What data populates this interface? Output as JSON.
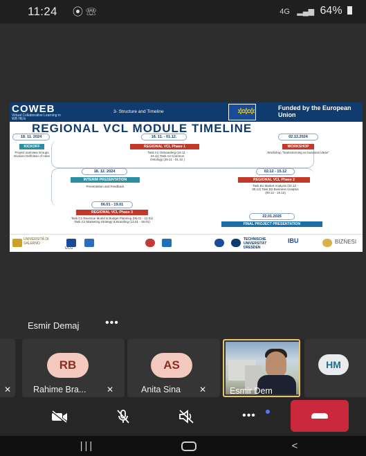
{
  "status_bar": {
    "time": "11:24",
    "left_icons": "⦿ ☏",
    "network": "4G",
    "battery": "64%"
  },
  "slide": {
    "brand": "COWEB",
    "brand_sub": "Virtual Collaborative Learning in WB HEIs",
    "section": "3- Structure and Timeline",
    "funding": "Funded by the European Union",
    "title": "REGIONAL VCL MODULE TIMELINE",
    "milestones": [
      {
        "date": "18. 11. 2024",
        "tag": "KICKOFF",
        "note": "Project overview Groups Division Definition of roles"
      },
      {
        "date": "18. 11. - 01.12.",
        "tag": "REGIONAL VCL Phase 1",
        "note": "Task A1 Onboarding (18.11 - 24.11)  Task A2 Common Ontology (25.11 - 01.12.)"
      },
      {
        "date": "02.12.2024",
        "tag": "WORKSHOP",
        "note": "Workshop \"brainstorming on business ideas\""
      },
      {
        "date": "18. 12. 2024",
        "tag": "INTERIM PRESENTATION",
        "note": "Presentation and Feedback"
      },
      {
        "date": "02.12 - 15.12",
        "tag": "REGIONAL VCL Phase 2",
        "note": "Task B1 Market Analysis (02.12 - 08.12)  Task B2 Business Analysis (09.12 - 15.12)"
      },
      {
        "date": "06.01 - 19.01",
        "tag": "REGIONAL VCL Phase 3",
        "note": "Task C1 Revenue Model & Budget Planning (06.01 - 12.01)  Task C2 Marketing Strategy & Branding (13.01 - 19.01)"
      },
      {
        "date": "22.01.2025",
        "tag": "FINAL PROJECT PRESENTATION",
        "note": ""
      }
    ],
    "logos": [
      "UNIVERSITÀ DI SALERNO",
      "UCG",
      "TECHNISCHE UNIVERSITÄT DRESDEN",
      "IBU",
      "BIZNESI"
    ]
  },
  "speaker": {
    "name": "Esmir Demaj",
    "more": "•••"
  },
  "participants": [
    {
      "initials": "RB",
      "name": "Rahime Bra...",
      "mic": "muted",
      "color": "#f4c9c0",
      "text_color": "#8a2d24"
    },
    {
      "initials": "AS",
      "name": "Anita  Sina",
      "mic": "muted",
      "color": "#f4c9c0",
      "text_color": "#8a2d24"
    },
    {
      "initials": "",
      "name": "Esmir Dem",
      "mic": "on",
      "video": true
    },
    {
      "initials": "HM",
      "name": "",
      "mic": "",
      "color": "#e8ecef",
      "text_color": "#1d6f8a"
    }
  ],
  "controls": {
    "camera": "camera-off",
    "mic": "mic-off",
    "speaker": "speaker-off",
    "more": "•••",
    "end": "end-call"
  },
  "navbar": {
    "recents": "|||",
    "back": "<"
  },
  "colors": {
    "accent_end_call": "#c9293a",
    "slide_header": "#0f3b6e",
    "phase_red": "#c0392b",
    "phase_blue": "#1d6fa5"
  }
}
